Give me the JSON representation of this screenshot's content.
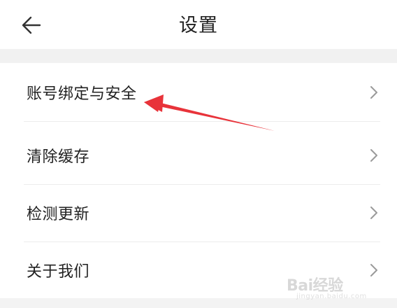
{
  "header": {
    "title": "设置",
    "back_icon": "arrow-left-icon"
  },
  "menu": {
    "items": [
      {
        "label": "账号绑定与安全",
        "icon": "chevron-right-icon"
      },
      {
        "label": "清除缓存",
        "icon": "chevron-right-icon"
      },
      {
        "label": "检测更新",
        "icon": "chevron-right-icon"
      },
      {
        "label": "关于我们",
        "icon": "chevron-right-icon"
      }
    ]
  },
  "annotation": {
    "type": "red-arrow",
    "target": "账号绑定与安全",
    "color": "#e8333a"
  },
  "watermark": {
    "logo": "Bai经验",
    "text": "经验",
    "url": "jingyan.baidu.com"
  },
  "colors": {
    "background": "#f4f4f4",
    "surface": "#ffffff",
    "text": "#222222",
    "chevron": "#9a9a9a",
    "separator": "#ececec"
  }
}
